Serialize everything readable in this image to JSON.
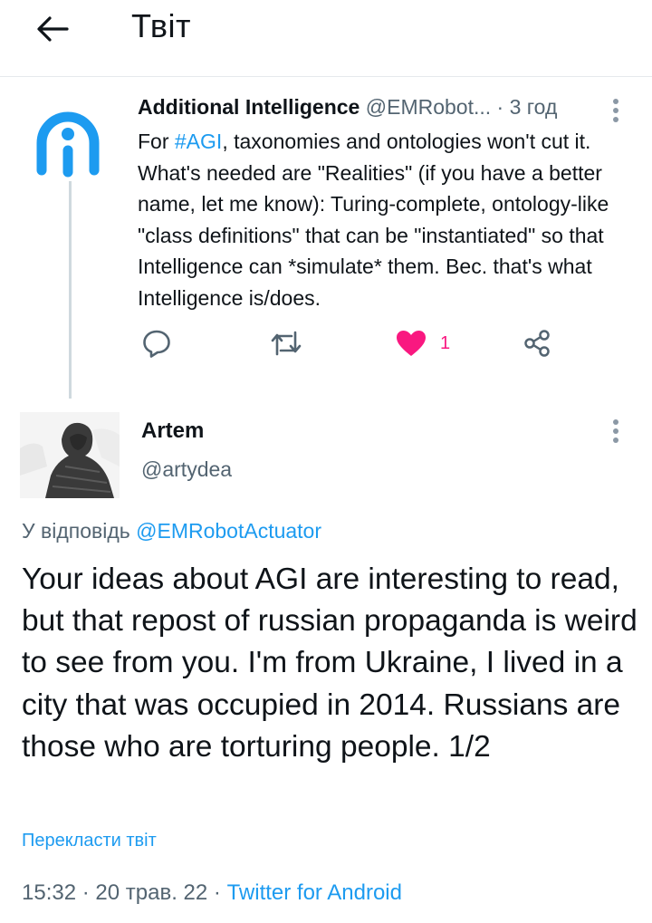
{
  "header": {
    "title": "Твіт"
  },
  "parent_tweet": {
    "name": "Additional Intelligence",
    "handle": "@EMRobot...",
    "separator": " · ",
    "time": "3 год",
    "text_prefix": "For ",
    "hashtag": "#AGI",
    "text_rest": ", taxonomies and ontologies won't cut it. What's needed are \"Realities\" (if you have a better name, let me know): Turing-complete, ontology-like \"class definitions\" that can be \"instantiated\" so that Intelligence can *simulate* them. Bec. that's what Intelligence is/does.",
    "like_count": "1"
  },
  "reply_tweet": {
    "name": "Artem",
    "handle": "@artydea",
    "replying_prefix": "У відповідь ",
    "replying_to": "@EMRobotActuator",
    "text": "Your ideas about AGI are interesting to read, but that repost of russian propaganda is weird to see from you. I'm from Ukraine, I lived in a city that was occupied in 2014. Russians are those who are torturing people. 1/2",
    "translate_label": "Перекласти твіт",
    "time": "15:32",
    "date": "20 трав. 22",
    "source": "Twitter for Android",
    "dot": " · "
  },
  "colors": {
    "accent": "#1d9bf0",
    "like": "#f91880",
    "secondary_text": "#536471",
    "icon_gray": "#536471"
  },
  "icons": [
    "back-arrow-icon",
    "more-vertical-icon",
    "reply-icon",
    "retweet-icon",
    "heart-icon",
    "share-icon"
  ]
}
